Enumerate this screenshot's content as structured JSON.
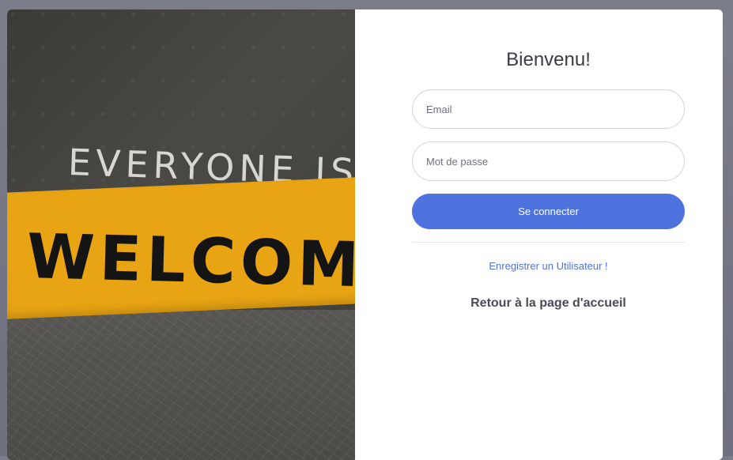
{
  "photo": {
    "line1": "EVERYONE IS",
    "line2": "WELCOME",
    "banner_color": "#e8a413"
  },
  "form": {
    "title": "Bienvenu!",
    "email_placeholder": "Email",
    "password_placeholder": "Mot de passe",
    "submit_label": "Se connecter",
    "register_link": "Enregistrer un Utilisateur !",
    "home_link": "Retour à la page d'accueil"
  },
  "colors": {
    "primary": "#4e73df",
    "text": "#3a3b45",
    "border": "#d1d3e2"
  }
}
